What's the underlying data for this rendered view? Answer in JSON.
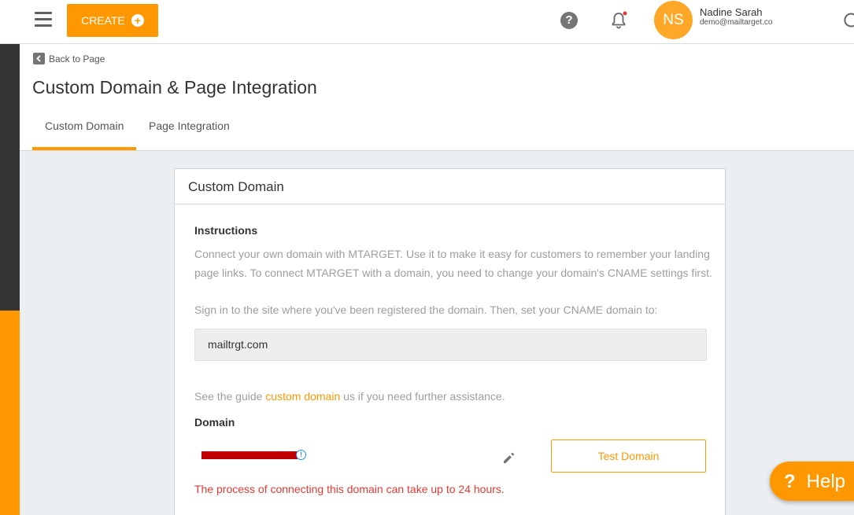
{
  "topbar": {
    "create_label": "CREATE",
    "user_initials": "NS",
    "user_name": "Nadine Sarah",
    "user_email": "demo@mailtarget.co",
    "accent_color": "#ff9800"
  },
  "header": {
    "back_label": "Back to Page",
    "title": "Custom Domain & Page Integration",
    "tabs": [
      {
        "label": "Custom Domain",
        "active": true
      },
      {
        "label": "Page Integration",
        "active": false
      }
    ]
  },
  "card": {
    "title": "Custom Domain",
    "instructions_heading": "Instructions",
    "instructions_text": "Connect your own domain with MTARGET. Use it to make it easy for customers to remember your landing page links. To connect MTARGET with a domain, you need to change your domain's CNAME settings first.",
    "cname_instruction": "Sign in to the site where you've been registered the domain. Then, set your CNAME domain to:",
    "cname_value": "mailtrgt.com",
    "guide_prefix": "See the guide ",
    "guide_link": "custom domain",
    "guide_suffix": " us if you need further assistance.",
    "domain_heading": "Domain",
    "domain_value": "",
    "test_button": "Test Domain",
    "warning": "The process of connecting this domain can take up to 24 hours."
  },
  "help": {
    "icon_label": "?",
    "label": "Help"
  }
}
